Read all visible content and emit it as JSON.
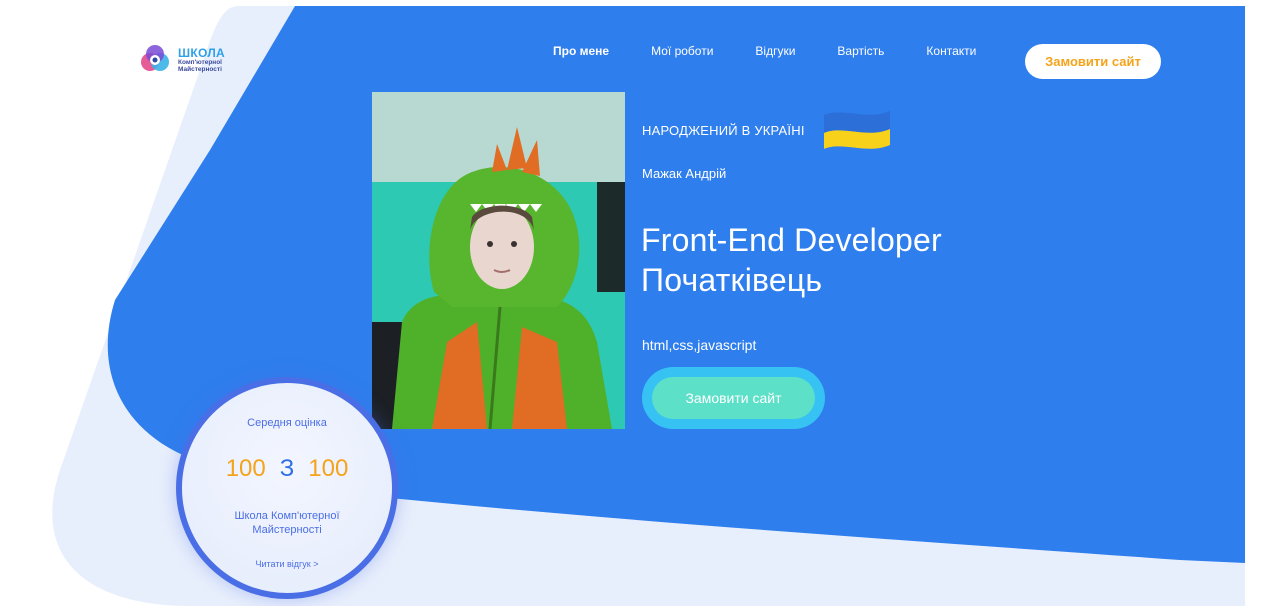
{
  "colors": {
    "brand_blue": "#2f7eed",
    "light_band": "#e6eefc",
    "accent_orange": "#f5a31a",
    "cta_outer": "#36c2f2",
    "cta_inner": "#5de0c8",
    "rating_border": "#4a6ee6"
  },
  "logo": {
    "title": "ШКОЛА",
    "subtitle_1": "Комп'ютерної",
    "subtitle_2": "Майстерності",
    "icon": "atom-logo-icon"
  },
  "nav": {
    "items": [
      {
        "label": "Про мене",
        "active": true
      },
      {
        "label": "Мої роботи",
        "active": false
      },
      {
        "label": "Відгуки",
        "active": false
      },
      {
        "label": "Вартість",
        "active": false
      },
      {
        "label": "Контакти",
        "active": false
      }
    ],
    "order_button": "Замовити сайт"
  },
  "hero": {
    "born": "НАРОДЖЕНИЙ В УКРАЇНІ",
    "flag_icon": "ukraine-flag-icon",
    "name": "Мажак Андрій",
    "headline_line1": "Front-End Developer",
    "headline_line2": "Початківець",
    "skills": "html,css,javascript",
    "cta": "Замовити сайт",
    "photo_icon": "profile-photo"
  },
  "rating": {
    "label": "Середня оцінка",
    "score": "100",
    "separator": "З",
    "max": "100",
    "school": "Школа Комп'ютерної Майстерності",
    "link": "Читати відгук >"
  }
}
